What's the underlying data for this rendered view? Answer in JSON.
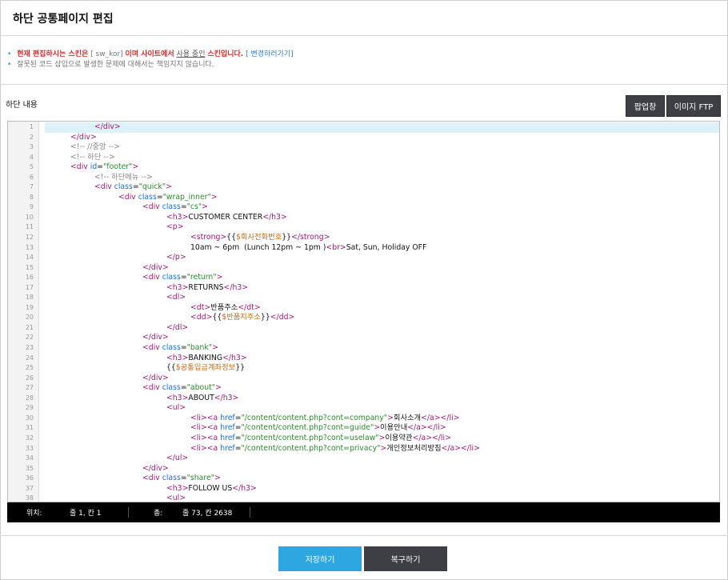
{
  "header": {
    "title": "하단 공통페이지 편집"
  },
  "notice": {
    "line1": {
      "prefix": "현재 편집하시는 스킨은",
      "skin": "[ sw_kor]",
      "mid": "이며 사이트에서",
      "status": "사용 중인",
      "suffix": "스킨입니다.",
      "link": "[ 변경하러가기]"
    },
    "line2": "잘못된 코드 삽입으로 발생한 문제에 대해서는 책임지지 않습니다."
  },
  "section": {
    "label": "하단 내용"
  },
  "toolbar": {
    "popup_label": "팝업창",
    "ftp_label": "이미지 FTP"
  },
  "status_bar": {
    "pos_label": "위치:",
    "pos_value": "줄 1, 칸 1",
    "total_label": "총:",
    "total_value": "줄 73, 칸 2638"
  },
  "footer_buttons": {
    "save_label": "저장하기",
    "restore_label": "복구하기"
  },
  "colors": {
    "accent": "#2ea7e0",
    "dark": "#3d3f44",
    "tag": "#a01a77",
    "attr": "#1a6fd2",
    "string": "#2e8a2e",
    "comment": "#888888",
    "variable": "#c26a16"
  },
  "code_lines": [
    {
      "n": "1",
      "i": 4,
      "p": [
        [
          "tag",
          "</div>"
        ]
      ]
    },
    {
      "n": "2",
      "i": 3,
      "p": [
        [
          "tag",
          "</div>"
        ]
      ]
    },
    {
      "n": "3",
      "i": 3,
      "p": [
        [
          "comment",
          "<!-- //중앙 -->"
        ]
      ]
    },
    {
      "n": "4",
      "i": 3,
      "p": [
        [
          "comment",
          "<!-- 하단 -->"
        ]
      ]
    },
    {
      "n": "5",
      "i": 3,
      "p": [
        [
          "tag",
          "<div "
        ],
        [
          "attr",
          "id"
        ],
        [
          "plain",
          "="
        ],
        [
          "str",
          "\"footer\""
        ],
        [
          "tag",
          ">"
        ]
      ]
    },
    {
      "n": "6",
      "i": 4,
      "p": [
        [
          "comment",
          "<!-- 하단메뉴 -->"
        ]
      ]
    },
    {
      "n": "7",
      "i": 4,
      "p": [
        [
          "tag",
          "<div "
        ],
        [
          "attr",
          "class"
        ],
        [
          "plain",
          "="
        ],
        [
          "str",
          "\"quick\""
        ],
        [
          "tag",
          ">"
        ]
      ]
    },
    {
      "n": "8",
      "i": 5,
      "p": [
        [
          "tag",
          "<div "
        ],
        [
          "attr",
          "class"
        ],
        [
          "plain",
          "="
        ],
        [
          "str",
          "\"wrap_inner\""
        ],
        [
          "tag",
          ">"
        ]
      ]
    },
    {
      "n": "9",
      "i": 6,
      "p": [
        [
          "tag",
          "<div "
        ],
        [
          "attr",
          "class"
        ],
        [
          "plain",
          "="
        ],
        [
          "str",
          "\"cs\""
        ],
        [
          "tag",
          ">"
        ]
      ]
    },
    {
      "n": "10",
      "i": 7,
      "p": [
        [
          "tag",
          "<h3>"
        ],
        [
          "plain",
          "CUSTOMER CENTER"
        ],
        [
          "tag",
          "</h3>"
        ]
      ]
    },
    {
      "n": "11",
      "i": 7,
      "p": [
        [
          "tag",
          "<p>"
        ]
      ]
    },
    {
      "n": "12",
      "i": 8,
      "p": [
        [
          "tag",
          "<strong>"
        ],
        [
          "plain",
          "{{"
        ],
        [
          "var",
          "$회사전화번호"
        ],
        [
          "plain",
          "}}"
        ],
        [
          "tag",
          "</strong>"
        ]
      ]
    },
    {
      "n": "13",
      "i": 8,
      "p": [
        [
          "plain",
          "10am ~ 6pm  (Lunch 12pm ~ 1pm )"
        ],
        [
          "tag",
          "<br>"
        ],
        [
          "plain",
          "Sat, Sun, Holiday OFF"
        ]
      ]
    },
    {
      "n": "14",
      "i": 7,
      "p": [
        [
          "tag",
          "</p>"
        ]
      ]
    },
    {
      "n": "15",
      "i": 6,
      "p": [
        [
          "tag",
          "</div>"
        ]
      ]
    },
    {
      "n": "16",
      "i": 6,
      "p": [
        [
          "tag",
          "<div "
        ],
        [
          "attr",
          "class"
        ],
        [
          "plain",
          "="
        ],
        [
          "str",
          "\"return\""
        ],
        [
          "tag",
          ">"
        ]
      ]
    },
    {
      "n": "17",
      "i": 7,
      "p": [
        [
          "tag",
          "<h3>"
        ],
        [
          "plain",
          "RETURNS"
        ],
        [
          "tag",
          "</h3>"
        ]
      ]
    },
    {
      "n": "18",
      "i": 7,
      "p": [
        [
          "tag",
          "<dl>"
        ]
      ]
    },
    {
      "n": "19",
      "i": 8,
      "p": [
        [
          "tag",
          "<dt>"
        ],
        [
          "plain",
          "반품주소"
        ],
        [
          "tag",
          "</dt>"
        ]
      ]
    },
    {
      "n": "20",
      "i": 8,
      "p": [
        [
          "tag",
          "<dd>"
        ],
        [
          "plain",
          "{{"
        ],
        [
          "var",
          "$반품지주소"
        ],
        [
          "plain",
          "}}"
        ],
        [
          "tag",
          "</dd>"
        ]
      ]
    },
    {
      "n": "21",
      "i": 7,
      "p": [
        [
          "tag",
          "</dl>"
        ]
      ]
    },
    {
      "n": "22",
      "i": 6,
      "p": [
        [
          "tag",
          "</div>"
        ]
      ]
    },
    {
      "n": "23",
      "i": 6,
      "p": [
        [
          "tag",
          "<div "
        ],
        [
          "attr",
          "class"
        ],
        [
          "plain",
          "="
        ],
        [
          "str",
          "\"bank\""
        ],
        [
          "tag",
          ">"
        ]
      ]
    },
    {
      "n": "24",
      "i": 7,
      "p": [
        [
          "tag",
          "<h3>"
        ],
        [
          "plain",
          "BANKING"
        ],
        [
          "tag",
          "</h3>"
        ]
      ]
    },
    {
      "n": "25",
      "i": 7,
      "p": [
        [
          "plain",
          "{{"
        ],
        [
          "var",
          "$공통입금계좌정보"
        ],
        [
          "plain",
          "}}"
        ]
      ]
    },
    {
      "n": "26",
      "i": 6,
      "p": [
        [
          "tag",
          "</div>"
        ]
      ]
    },
    {
      "n": "27",
      "i": 6,
      "p": [
        [
          "tag",
          "<div "
        ],
        [
          "attr",
          "class"
        ],
        [
          "plain",
          "="
        ],
        [
          "str",
          "\"about\""
        ],
        [
          "tag",
          ">"
        ]
      ]
    },
    {
      "n": "28",
      "i": 7,
      "p": [
        [
          "tag",
          "<h3>"
        ],
        [
          "plain",
          "ABOUT"
        ],
        [
          "tag",
          "</h3>"
        ]
      ]
    },
    {
      "n": "29",
      "i": 7,
      "p": [
        [
          "tag",
          "<ul>"
        ]
      ]
    },
    {
      "n": "30",
      "i": 8,
      "p": [
        [
          "tag",
          "<li><a "
        ],
        [
          "attr",
          "href"
        ],
        [
          "plain",
          "="
        ],
        [
          "str",
          "\"/content/content.php?cont=company\""
        ],
        [
          "tag",
          ">"
        ],
        [
          "plain",
          "회사소개"
        ],
        [
          "tag",
          "</a></li>"
        ]
      ]
    },
    {
      "n": "31",
      "i": 8,
      "p": [
        [
          "tag",
          "<li><a "
        ],
        [
          "attr",
          "href"
        ],
        [
          "plain",
          "="
        ],
        [
          "str",
          "\"/content/content.php?cont=guide\""
        ],
        [
          "tag",
          ">"
        ],
        [
          "plain",
          "이용안내"
        ],
        [
          "tag",
          "</a></li>"
        ]
      ]
    },
    {
      "n": "32",
      "i": 8,
      "p": [
        [
          "tag",
          "<li><a "
        ],
        [
          "attr",
          "href"
        ],
        [
          "plain",
          "="
        ],
        [
          "str",
          "\"/content/content.php?cont=uselaw\""
        ],
        [
          "tag",
          ">"
        ],
        [
          "plain",
          "이용약관"
        ],
        [
          "tag",
          "</a></li>"
        ]
      ]
    },
    {
      "n": "33",
      "i": 8,
      "p": [
        [
          "tag",
          "<li><a "
        ],
        [
          "attr",
          "href"
        ],
        [
          "plain",
          "="
        ],
        [
          "str",
          "\"/content/content.php?cont=privacy\""
        ],
        [
          "tag",
          ">"
        ],
        [
          "plain",
          "개인정보처리방침"
        ],
        [
          "tag",
          "</a></li>"
        ]
      ]
    },
    {
      "n": "34",
      "i": 7,
      "p": [
        [
          "tag",
          "</ul>"
        ]
      ]
    },
    {
      "n": "35",
      "i": 6,
      "p": [
        [
          "tag",
          "</div>"
        ]
      ]
    },
    {
      "n": "36",
      "i": 6,
      "p": [
        [
          "tag",
          "<div "
        ],
        [
          "attr",
          "class"
        ],
        [
          "plain",
          "="
        ],
        [
          "str",
          "\"share\""
        ],
        [
          "tag",
          ">"
        ]
      ]
    },
    {
      "n": "37",
      "i": 7,
      "p": [
        [
          "tag",
          "<h3>"
        ],
        [
          "plain",
          "FOLLOW US"
        ],
        [
          "tag",
          "</h3>"
        ]
      ]
    },
    {
      "n": "38",
      "i": 7,
      "p": [
        [
          "tag",
          "<ul>"
        ]
      ]
    }
  ]
}
